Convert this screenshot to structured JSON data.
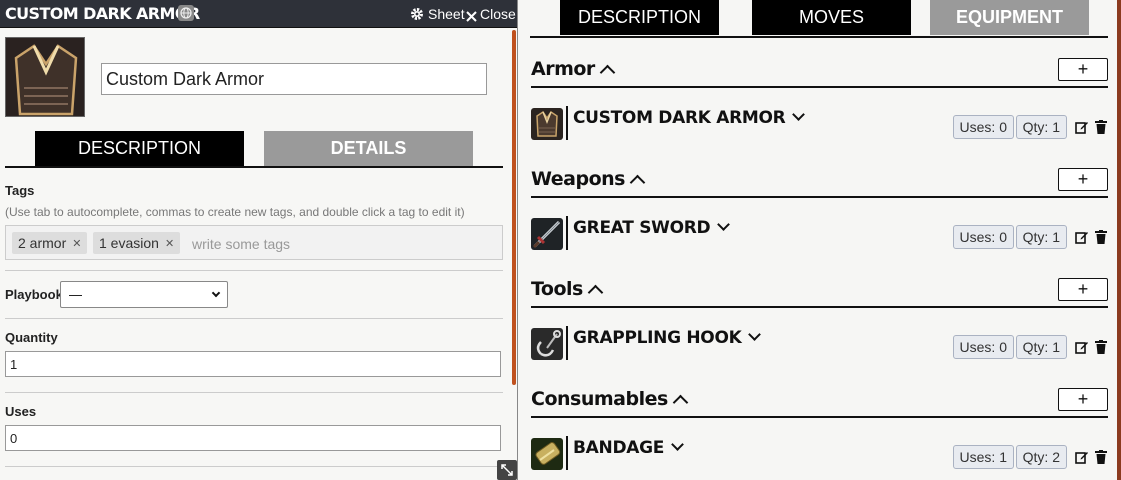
{
  "sheet": {
    "tabs": [
      {
        "label": "DESCRIPTION",
        "active": false
      },
      {
        "label": "MOVES",
        "active": false
      },
      {
        "label": "EQUIPMENT",
        "active": true
      }
    ],
    "sections": [
      {
        "title": "Armor",
        "add_label": "+",
        "items": [
          {
            "name": "CUSTOM DARK ARMOR",
            "uses": "Uses: 0",
            "qty": "Qty: 1",
            "icon": "armor-icon"
          }
        ]
      },
      {
        "title": "Weapons",
        "add_label": "+",
        "items": [
          {
            "name": "GREAT SWORD",
            "uses": "Uses: 0",
            "qty": "Qty: 1",
            "icon": "sword-icon"
          }
        ]
      },
      {
        "title": "Tools",
        "add_label": "+",
        "items": [
          {
            "name": "GRAPPLING HOOK",
            "uses": "Uses: 0",
            "qty": "Qty: 1",
            "icon": "grappling-hook-icon"
          }
        ]
      },
      {
        "title": "Consumables",
        "add_label": "+",
        "items": [
          {
            "name": "BANDAGE",
            "uses": "Uses: 1",
            "qty": "Qty: 2",
            "icon": "bandage-icon"
          }
        ]
      }
    ]
  },
  "window": {
    "title": "CUSTOM DARK ARMOR",
    "sheet_label": "Sheet",
    "close_label": "Close",
    "name_value": "Custom Dark Armor",
    "tabs": [
      {
        "label": "DESCRIPTION",
        "active": true
      },
      {
        "label": "DETAILS",
        "active": false
      }
    ],
    "tags": {
      "label": "Tags",
      "hint": "(Use tab to autocomplete, commas to create new tags, and double click a tag to edit it)",
      "values": [
        "2 armor",
        "1 evasion"
      ],
      "placeholder": "write some tags"
    },
    "playbook": {
      "label": "Playbook",
      "value": "—"
    },
    "quantity": {
      "label": "Quantity",
      "value": "1"
    },
    "uses": {
      "label": "Uses",
      "value": "0"
    }
  },
  "colors": {
    "tab_dark": "#000000",
    "tab_active": "#9a9a9a",
    "header_bg": "#2e3139",
    "accent": "#c0511e",
    "pill_bg": "#e8ebf0"
  }
}
